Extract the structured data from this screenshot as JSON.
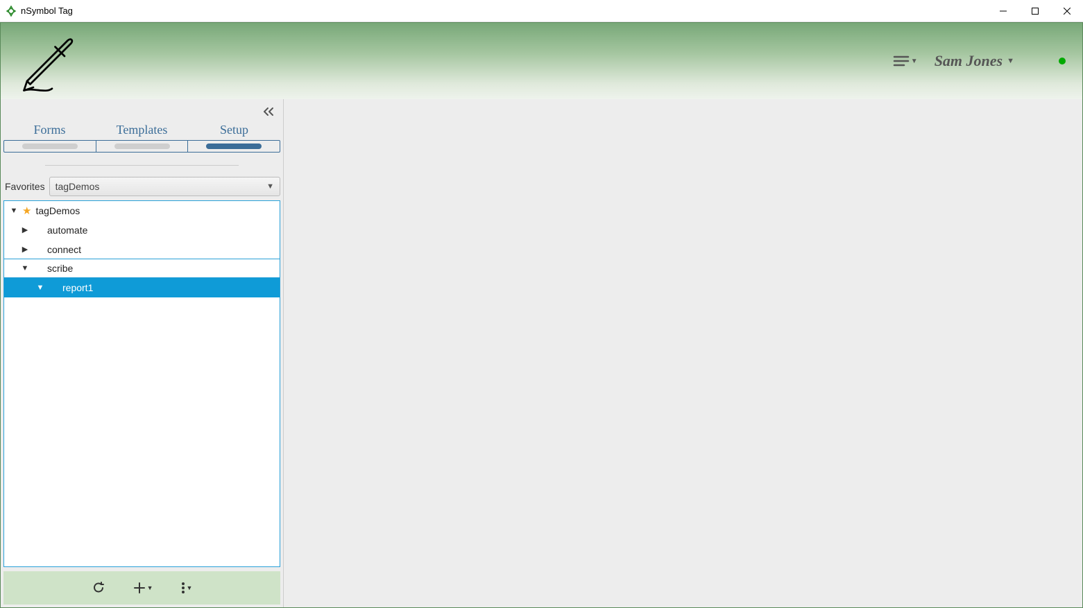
{
  "window": {
    "title": "nSymbol Tag"
  },
  "header": {
    "user_name": "Sam Jones"
  },
  "sidebar": {
    "tabs": [
      {
        "label": "Forms",
        "active": false
      },
      {
        "label": "Templates",
        "active": false
      },
      {
        "label": "Setup",
        "active": true
      }
    ],
    "favorites_label": "Favorites",
    "favorites_selected": "tagDemos",
    "tree": {
      "root": {
        "label": "tagDemos",
        "expanded": true,
        "starred": true
      },
      "children": [
        {
          "label": "automate",
          "expanded": false
        },
        {
          "label": "connect",
          "expanded": false
        },
        {
          "label": "scribe",
          "expanded": true,
          "outlined": true,
          "children": [
            {
              "label": "report1",
              "expanded": true,
              "selected": true
            }
          ]
        }
      ]
    }
  }
}
